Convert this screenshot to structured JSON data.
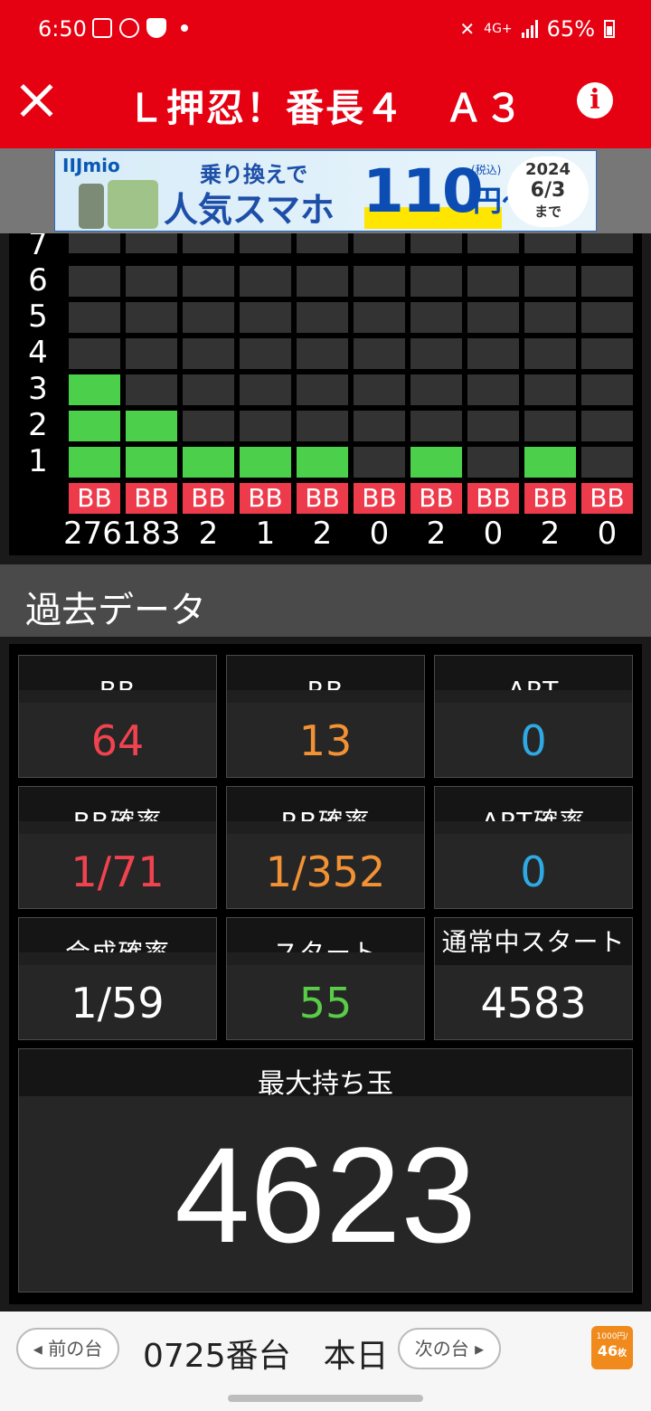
{
  "status": {
    "time": "6:50",
    "network": "4G+",
    "battery": "65%"
  },
  "header": {
    "title": "Ｌ押忍！番長４　Ａ３",
    "close_label": "close",
    "info_label": "i"
  },
  "ad": {
    "brand": "IIJmio",
    "line1": "乗り換えで",
    "line2": "人気スマホ",
    "price": "110",
    "yen": "円〜",
    "tax": "(税込)",
    "date_year": "2024",
    "date_day": "6/3",
    "date_suffix": "まで"
  },
  "history_graph": {
    "y_labels": [
      "7",
      "6",
      "5",
      "4",
      "3",
      "2",
      "1"
    ],
    "bonus_types": [
      "BB",
      "BB",
      "BB",
      "BB",
      "BB",
      "BB",
      "BB",
      "BB",
      "BB",
      "BB"
    ],
    "levels": [
      3,
      2,
      1,
      1,
      1,
      0,
      1,
      0,
      1,
      0
    ],
    "counts_wide": "276183",
    "counts": [
      "2",
      "1",
      "2",
      "0",
      "2",
      "0",
      "2",
      "0"
    ]
  },
  "section": {
    "title": "過去データ"
  },
  "stats": {
    "bb": {
      "label": "BB",
      "value": "64"
    },
    "rb": {
      "label": "RB",
      "value": "13"
    },
    "art": {
      "label": "ART",
      "value": "0"
    },
    "bb_prob": {
      "label": "BB確率",
      "value": "1/71"
    },
    "rb_prob": {
      "label": "RB確率",
      "value": "1/352"
    },
    "art_prob": {
      "label": "ART確率",
      "value": "0"
    },
    "total_prob": {
      "label": "合成確率",
      "value": "1/59"
    },
    "start": {
      "label": "スタート",
      "value": "55"
    },
    "normal_start": {
      "label": "通常中スタート",
      "value": "4583"
    },
    "max_coins": {
      "label": "最大持ち玉",
      "value": "4623"
    }
  },
  "colors": {
    "accent": "#e50012",
    "bb": "#f0434f",
    "rb": "#f39234",
    "art": "#2fa9e4",
    "start": "#59cc48",
    "bar_on": "#4cd04c"
  },
  "footer": {
    "prev_label": "前の台",
    "machine": "0725番台",
    "day": "本日",
    "next_label": "次の台",
    "badge_top": "1000円/",
    "badge_value": "46",
    "badge_unit": "枚"
  }
}
